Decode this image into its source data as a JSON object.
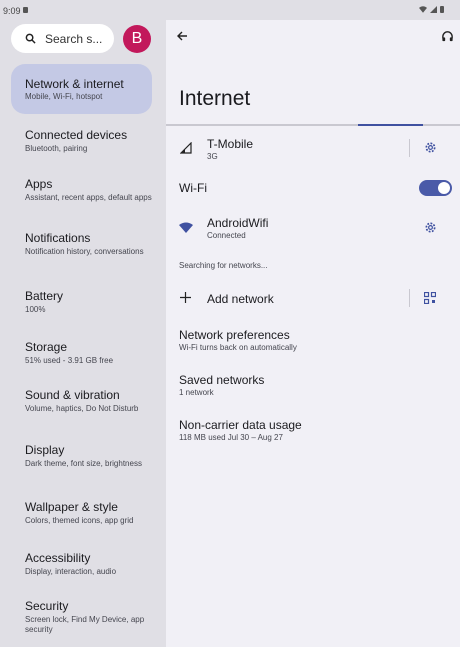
{
  "status_bar": {
    "time": "9:09"
  },
  "sidebar": {
    "search_placeholder": "Search s...",
    "avatar_letter": "B",
    "items": [
      {
        "title": "Network & internet",
        "subtitle": "Mobile, Wi-Fi, hotspot"
      },
      {
        "title": "Connected devices",
        "subtitle": "Bluetooth, pairing"
      },
      {
        "title": "Apps",
        "subtitle": "Assistant, recent apps, default apps"
      },
      {
        "title": "Notifications",
        "subtitle": "Notification history, conversations"
      },
      {
        "title": "Battery",
        "subtitle": "100%"
      },
      {
        "title": "Storage",
        "subtitle": "51% used - 3.91 GB free"
      },
      {
        "title": "Sound & vibration",
        "subtitle": "Volume, haptics, Do Not Disturb"
      },
      {
        "title": "Display",
        "subtitle": "Dark theme, font size, brightness"
      },
      {
        "title": "Wallpaper & style",
        "subtitle": "Colors, themed icons, app grid"
      },
      {
        "title": "Accessibility",
        "subtitle": "Display, interaction, audio"
      },
      {
        "title": "Security",
        "subtitle": "Screen lock, Find My Device, app security"
      }
    ]
  },
  "main": {
    "title": "Internet",
    "carrier": {
      "name": "T-Mobile",
      "type": "3G"
    },
    "wifi_label": "Wi-Fi",
    "wifi_on": true,
    "network": {
      "name": "AndroidWifi",
      "status": "Connected"
    },
    "searching_text": "Searching for networks...",
    "add_network": "Add network",
    "prefs": {
      "title": "Network preferences",
      "subtitle": "Wi-Fi turns back on automatically"
    },
    "saved": {
      "title": "Saved networks",
      "subtitle": "1 network"
    },
    "usage": {
      "title": "Non-carrier data usage",
      "subtitle": "118 MB used Jul 30 – Aug 27"
    }
  },
  "colors": {
    "accent": "#4a5aa8",
    "selected_bg": "#c4c9e5",
    "avatar_bg": "#c2185b"
  }
}
